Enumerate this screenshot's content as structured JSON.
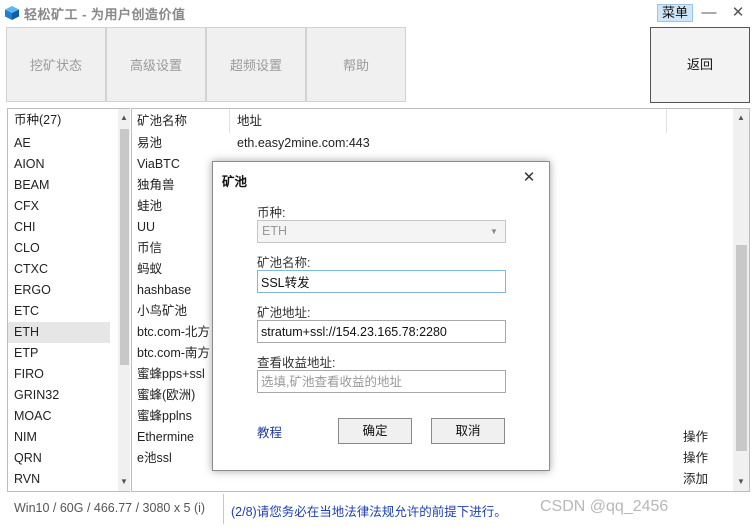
{
  "window": {
    "title": "轻松矿工 - 为用户创造价值",
    "menu_label": "菜单",
    "minimize_glyph": "—",
    "close_glyph": "✕"
  },
  "toolbar": {
    "tabs": [
      "挖矿状态",
      "高级设置",
      "超频设置",
      "帮助"
    ],
    "back_label": "返回"
  },
  "coins": {
    "header": "币种(27)",
    "items": [
      "AE",
      "AION",
      "BEAM",
      "CFX",
      "CHI",
      "CLO",
      "CTXC",
      "ERGO",
      "ETC",
      "ETH",
      "ETP",
      "FIRO",
      "GRIN32",
      "MOAC",
      "NIM",
      "QRN",
      "RVN"
    ],
    "selected": "ETH"
  },
  "pools": {
    "columns": [
      "矿池名称",
      "地址"
    ],
    "rows": [
      {
        "name": "易池",
        "address": "eth.easy2mine.com:443",
        "op": ""
      },
      {
        "name": "ViaBTC",
        "address": "",
        "op": ""
      },
      {
        "name": "独角兽",
        "address": "",
        "op": ""
      },
      {
        "name": "蛙池",
        "address": "",
        "op": ""
      },
      {
        "name": "UU",
        "address": "",
        "op": ""
      },
      {
        "name": "币信",
        "address": "",
        "op": ""
      },
      {
        "name": "蚂蚁",
        "address": "",
        "op": ""
      },
      {
        "name": "hashbase",
        "address": "",
        "op": ""
      },
      {
        "name": "小鸟矿池",
        "address": "",
        "op": ""
      },
      {
        "name": "btc.com-北方",
        "address": "",
        "op": ""
      },
      {
        "name": "btc.com-南方",
        "address": "",
        "op": ""
      },
      {
        "name": "蜜蜂pps+ssl",
        "address": "",
        "op": ""
      },
      {
        "name": "蜜蜂(欧洲)",
        "address": "",
        "op": ""
      },
      {
        "name": "蜜蜂pplns",
        "address": "",
        "op": ""
      },
      {
        "name": "Ethermine",
        "address": "",
        "op": "操作"
      },
      {
        "name": "e池ssl",
        "address": "",
        "op": "操作"
      },
      {
        "name": "",
        "address": "",
        "op": "添加"
      }
    ]
  },
  "status": {
    "system": "Win10  / 60G / 466.77 / 3080 x 5 (i)",
    "notice": "(2/8)请您务必在当地法律法规允许的前提下进行。",
    "watermark": "CSDN @qq_2456"
  },
  "dialog": {
    "title": "矿池",
    "close_glyph": "✕",
    "coin_label": "币种:",
    "coin_value": "ETH",
    "pool_name_label": "矿池名称:",
    "pool_name_value": "SSL转发",
    "pool_addr_label": "矿池地址:",
    "pool_addr_value": "stratum+ssl://154.23.165.78:2280",
    "earnings_label": "查看收益地址:",
    "earnings_placeholder": "选填,矿池查看收益的地址",
    "tutorial_label": "教程",
    "ok_label": "确定",
    "cancel_label": "取消"
  },
  "colors": {
    "accent_blue": "#1e3fb4",
    "menu_bg": "#cfe6f7",
    "selection": "#e6e6e6"
  },
  "icons": {
    "app_logo": "blue-cube-logo-icon",
    "dropdown": "chevron-down-icon",
    "scroll_up": "triangle-up-icon",
    "scroll_down": "triangle-down-icon"
  }
}
